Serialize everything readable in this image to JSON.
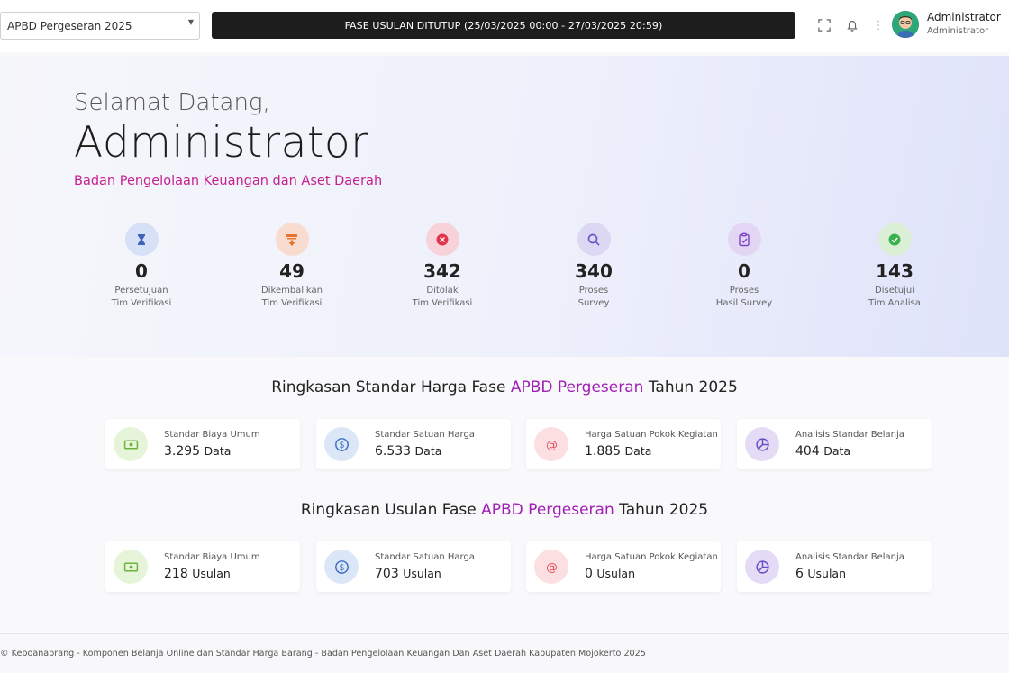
{
  "header": {
    "budget_select": "APBD Pergeseran 2025",
    "phase_banner": "FASE USULAN DITUTUP (25/03/2025 00:00 - 27/03/2025 20:59)",
    "user_name": "Administrator",
    "user_role": "Administrator"
  },
  "hero": {
    "greeting": "Selamat Datang,",
    "name": "Administrator",
    "organization": "Badan Pengelolaan Keuangan dan Aset Daerah"
  },
  "stats": [
    {
      "value": "0",
      "line1": "Persetujuan",
      "line2": "Tim Verifikasi",
      "icon": "hourglass-icon"
    },
    {
      "value": "49",
      "line1": "Dikembalikan",
      "line2": "Tim Verifikasi",
      "icon": "return-icon"
    },
    {
      "value": "342",
      "line1": "Ditolak",
      "line2": "Tim Verifikasi",
      "icon": "reject-icon"
    },
    {
      "value": "340",
      "line1": "Proses",
      "line2": "Survey",
      "icon": "search-icon"
    },
    {
      "value": "0",
      "line1": "Proses",
      "line2": "Hasil Survey",
      "icon": "clipboard-icon"
    },
    {
      "value": "143",
      "line1": "Disetujui",
      "line2": "Tim Analisa",
      "icon": "check-icon"
    }
  ],
  "standard_summary": {
    "title_prefix": "Ringkasan Standar Harga Fase",
    "title_highlight": "APBD Pergeseran",
    "title_suffix": "Tahun 2025",
    "cards": [
      {
        "label": "Standar Biaya Umum",
        "value": "3.295",
        "unit": "Data"
      },
      {
        "label": "Standar Satuan Harga",
        "value": "6.533",
        "unit": "Data"
      },
      {
        "label": "Harga Satuan Pokok Kegiatan",
        "value": "1.885",
        "unit": "Data"
      },
      {
        "label": "Analisis Standar Belanja",
        "value": "404",
        "unit": "Data"
      }
    ]
  },
  "proposal_summary": {
    "title_prefix": "Ringkasan Usulan Fase",
    "title_highlight": "APBD Pergeseran",
    "title_suffix": "Tahun 2025",
    "cards": [
      {
        "label": "Standar Biaya Umum",
        "value": "218",
        "unit": "Usulan"
      },
      {
        "label": "Standar Satuan Harga",
        "value": "703",
        "unit": "Usulan"
      },
      {
        "label": "Harga Satuan Pokok Kegiatan",
        "value": "0",
        "unit": "Usulan"
      },
      {
        "label": "Analisis Standar Belanja",
        "value": "6",
        "unit": "Usulan"
      }
    ]
  },
  "footer": {
    "text": "© Keboanabrang - Komponen Belanja Online dan Standar Harga Barang - Badan Pengelolaan Keuangan Dan Aset Daerah Kabupaten Mojokerto 2025"
  },
  "colors": {
    "accent_magenta": "#c51f90",
    "highlight_purple": "#a01fb4",
    "banner_bg": "#1d1d1d"
  }
}
